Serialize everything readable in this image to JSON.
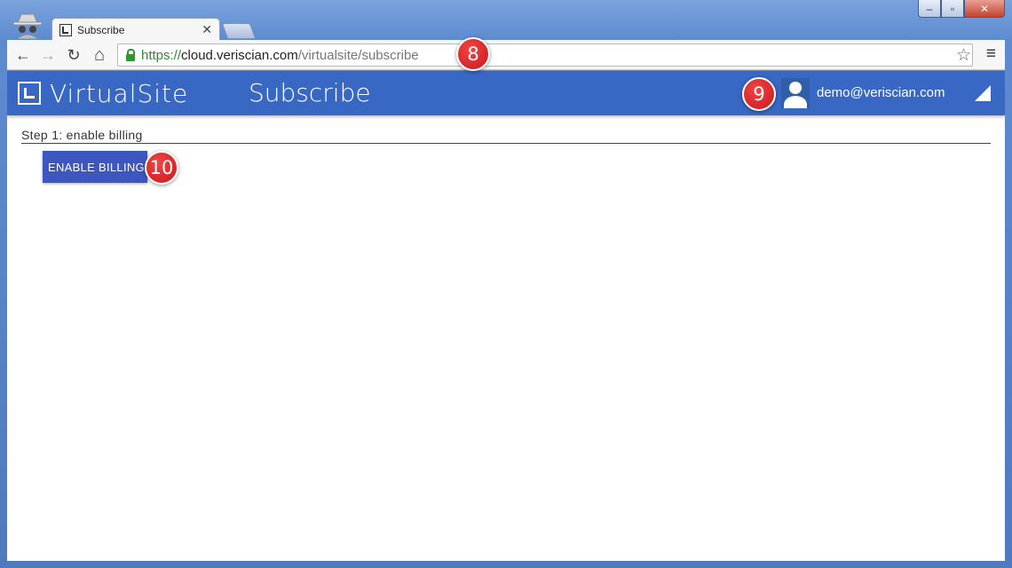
{
  "browser": {
    "tab_title": "Subscribe",
    "tab_close": "✕",
    "url_scheme": "https://",
    "url_host": "cloud.veriscian.com",
    "url_path": "/virtualsite/subscribe",
    "nav_back": "←",
    "nav_forward": "→",
    "nav_reload": "↻",
    "nav_home": "⌂",
    "bookmark_star": "☆",
    "menu_icon": "≡",
    "win_min": "‒",
    "win_max": "▫",
    "win_close": "✕"
  },
  "app": {
    "logo_text": "VirtualSite",
    "page_title": "Subscribe",
    "user_email": "demo@veriscian.com",
    "brand_color": "#3868c4"
  },
  "content": {
    "step_label": "Step 1: enable billing",
    "enable_billing_label": "ENABLE BILLING"
  },
  "annotations": {
    "badge_url": "8",
    "badge_user": "9",
    "badge_button": "10"
  }
}
